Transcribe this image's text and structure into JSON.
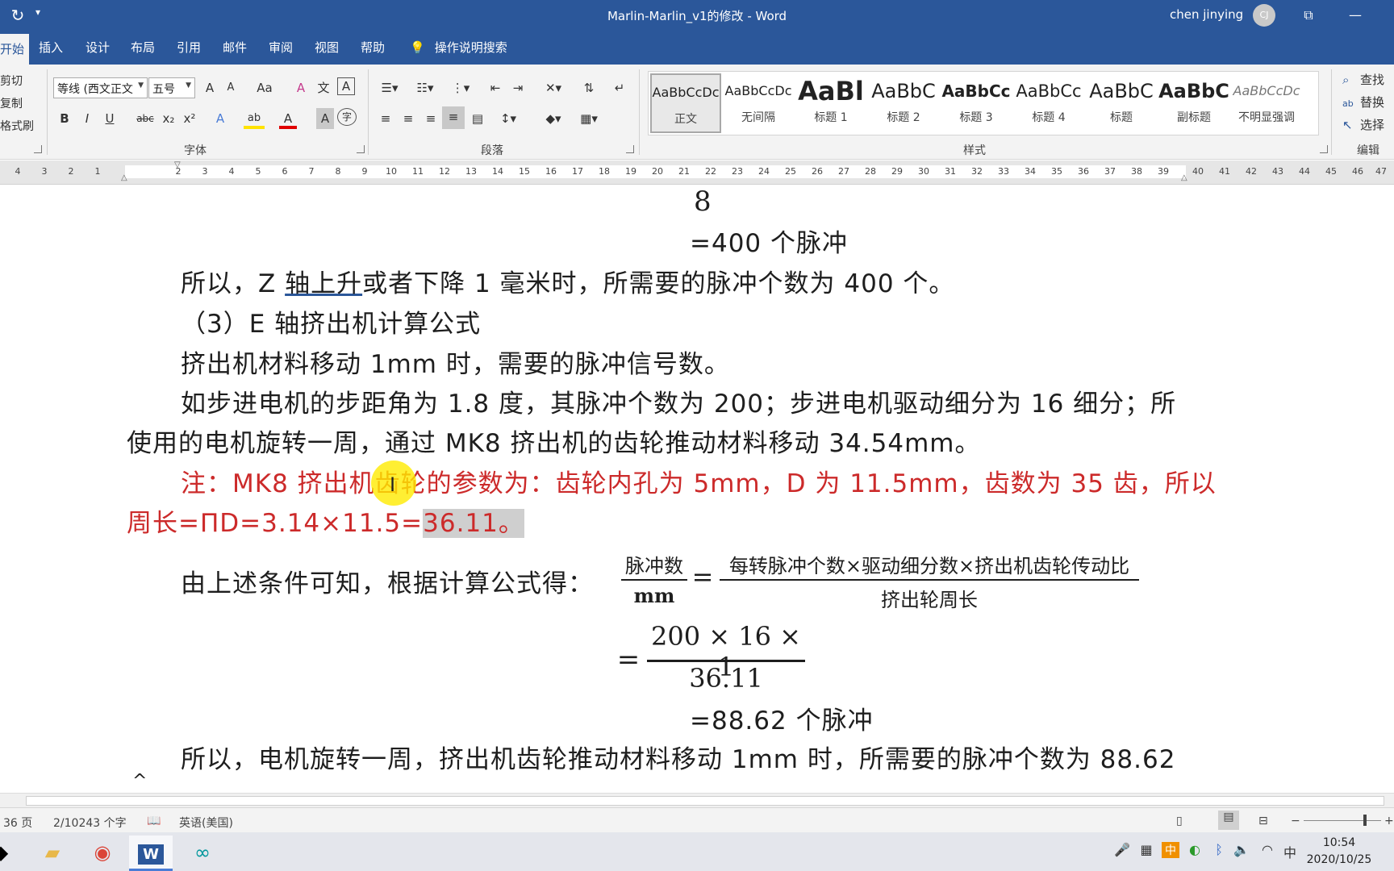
{
  "window": {
    "title": "Marlin-Marlin_v1的修改  -  Word",
    "user": "chen jinying",
    "avatar": "CJ",
    "autosave_icon": "autosave-icon",
    "qa_more": "₹"
  },
  "tabs": [
    {
      "label": "开始"
    },
    {
      "label": "插入"
    },
    {
      "label": "设计"
    },
    {
      "label": "布局"
    },
    {
      "label": "引用"
    },
    {
      "label": "邮件"
    },
    {
      "label": "审阅"
    },
    {
      "label": "视图"
    },
    {
      "label": "帮助"
    }
  ],
  "tell_me": "操作说明搜索",
  "clipboard": {
    "cut": "剪切",
    "copy": "复制",
    "format_painter": "格式刷"
  },
  "font": {
    "family": "等线 (西文正文",
    "size": "五号",
    "group_label": "字体",
    "bold": "B",
    "italic": "I",
    "underline": "U",
    "strike": "abc",
    "subscript": "x₂",
    "superscript": "x²",
    "grow": "A",
    "shrink": "A",
    "change_case": "Aa",
    "clear_format": "A",
    "phonetic": "文",
    "char_border": "A",
    "text_effect": "A",
    "highlight": "ab",
    "font_color": "A",
    "char_shading": "A",
    "enclose": "字"
  },
  "paragraph": {
    "group_label": "段落"
  },
  "styles": {
    "group_label": "样式",
    "items": [
      {
        "sample": "AaBbCcDc",
        "name": "正文"
      },
      {
        "sample": "AaBbCcDc",
        "name": "无间隔"
      },
      {
        "sample": "AaBl",
        "name": "标题 1"
      },
      {
        "sample": "AaBbC",
        "name": "标题 2"
      },
      {
        "sample": "AaBbCc",
        "name": "标题 3"
      },
      {
        "sample": "AaBbCc",
        "name": "标题 4"
      },
      {
        "sample": "AaBbC",
        "name": "标题"
      },
      {
        "sample": "AaBbC",
        "name": "副标题"
      },
      {
        "sample": "AaBbCcDc",
        "name": "不明显强调"
      }
    ]
  },
  "editing": {
    "group_label": "编辑",
    "find": "查找",
    "replace": "替换",
    "select": "选择"
  },
  "ruler": {
    "left_ticks": [
      "4",
      "3",
      "2",
      "1"
    ],
    "right_ticks": [
      "2",
      "3",
      "4",
      "5",
      "6",
      "7",
      "8",
      "9",
      "10",
      "11",
      "12",
      "13",
      "14",
      "15",
      "16",
      "17",
      "18",
      "19",
      "20",
      "21",
      "22",
      "23",
      "24",
      "25",
      "26",
      "27",
      "28",
      "29",
      "30",
      "31",
      "32",
      "33",
      "34",
      "35",
      "36",
      "37",
      "38",
      "39",
      "40",
      "41",
      "42",
      "43",
      "44",
      "45",
      "46",
      "47"
    ]
  },
  "document": {
    "frac_denominator_top": "8",
    "result_400": "=400 个脉冲",
    "para1_a": "所以，Z ",
    "para1_b": "轴上升",
    "para1_c": "或者下降 1 毫米时，所需要的脉冲个数为 400 个。",
    "heading3": "（3）E 轴挤出机计算公式",
    "para2": "挤出机材料移动 1mm 时，需要的脉冲信号数。",
    "para3_l1": "如步进电机的步距角为 1.8 度，其脉冲个数为 200；步进电机驱动细分为 16 细分；所",
    "para3_l2": "使用的电机旋转一周，通过 MK8 挤出机的齿轮推动材料移动 34.54mm。",
    "note_l1": "注：MK8 挤出机齿轮的参数为：齿轮内孔为 5mm，D 为 11.5mm，齿数为 35 齿，所以",
    "note_l2_a": "周长=ΠD=3.14×11.5=",
    "note_l2_b": "36.11。",
    "para4": "由上述条件可知，根据计算公式得：",
    "eq_lhs_num": "脉冲数",
    "eq_lhs_den": "mm",
    "eq_equals": "=",
    "eq_rhs_num": "每转脉冲个数×驱动细分数×挤出机齿轮传动比",
    "eq_rhs_den": "挤出轮周长",
    "eq2_equals": "=",
    "eq2_num": "200 × 16 × 1",
    "eq2_den": "36.11",
    "result_88": "=88.62 个脉冲",
    "para5": "所以，电机旋转一周，挤出机齿轮推动材料移动 1mm 时，所需要的脉冲个数为 88.62"
  },
  "status": {
    "page": "36 页",
    "words": "2/10243 个字",
    "language": "英语(美国)"
  },
  "taskbar": {
    "time": "10:54",
    "date": "2020/10/25",
    "ime": "中",
    "tray_lang": "中"
  }
}
